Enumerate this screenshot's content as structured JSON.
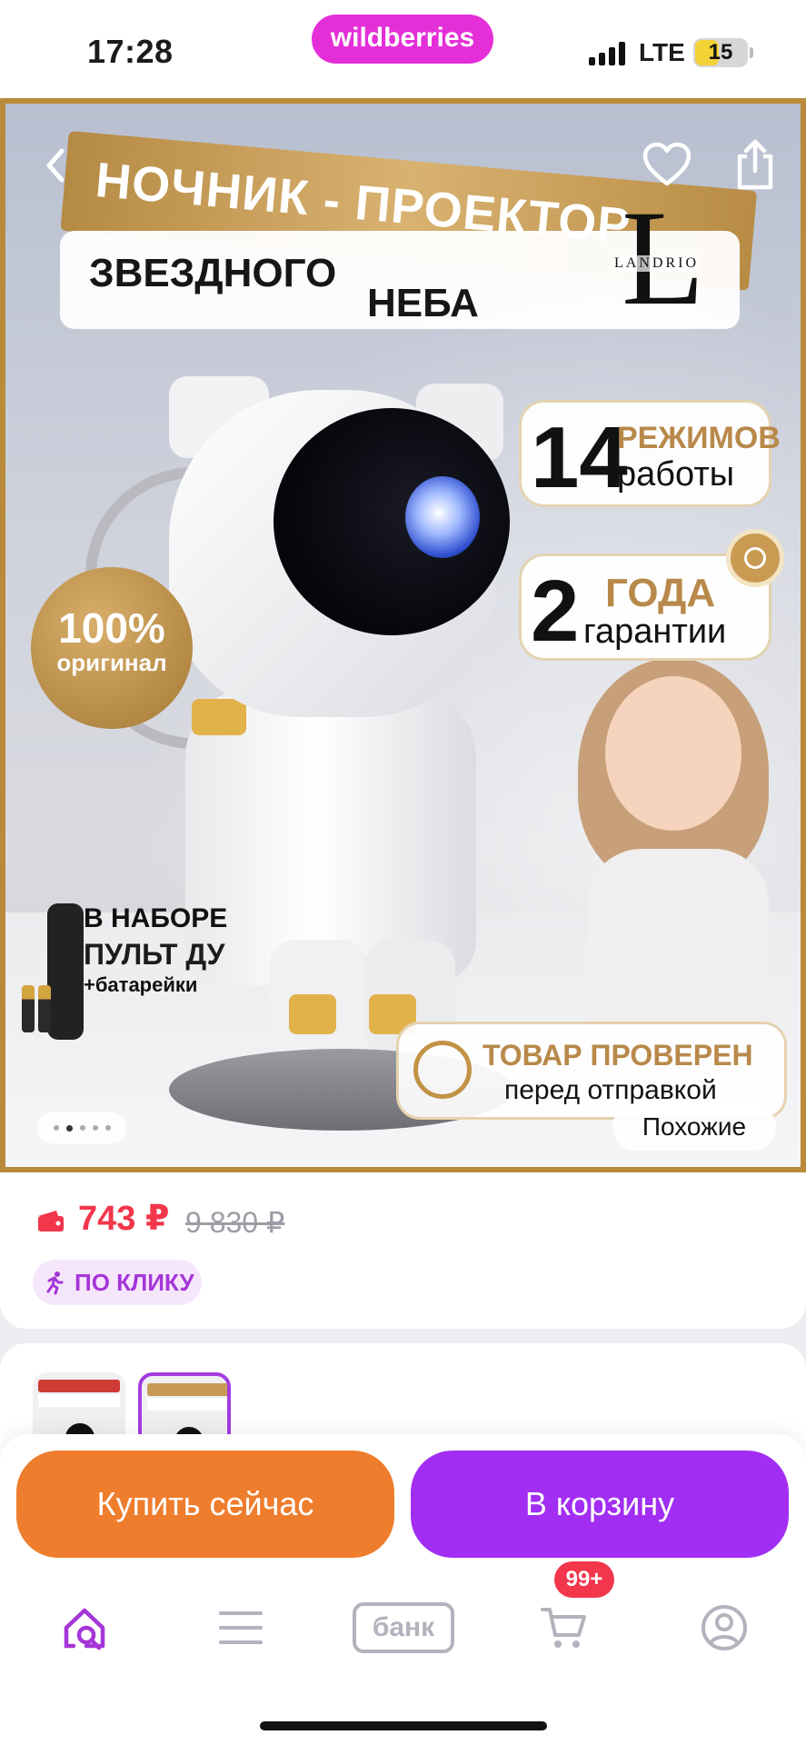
{
  "status_bar": {
    "time": "17:28",
    "brand": "wildberries",
    "network": "LTE",
    "battery": "15"
  },
  "product_image": {
    "headline": "НОЧНИК - ПРОЕКТОР",
    "subline_1": "ЗВЕЗДНОГО",
    "subline_2": "НЕБА",
    "logo_letter": "L",
    "logo_word": "LANDRIO",
    "modes_number": "14",
    "modes_top": "РЕЖИМОВ",
    "modes_bottom": "работы",
    "warranty_number": "2",
    "warranty_top": "ГОДА",
    "warranty_bottom": "гарантии",
    "seal_top": "100%",
    "seal_bottom": "оригинал",
    "kit_line_1": "В НАБОРЕ",
    "kit_line_2": "ПУЛЬТ ДУ",
    "kit_line_3": "+батарейки",
    "checked_line_1": "ТОВАР ПРОВЕРЕН",
    "checked_line_2": "перед отправкой",
    "similar_button": "Похожие",
    "carousel_dots": 5,
    "carousel_active_index": 1
  },
  "icons": {
    "back": "chevron-left-icon",
    "favorite": "heart-icon",
    "share": "share-icon",
    "wallet": "wallet-icon",
    "click": "running-person-icon"
  },
  "price": {
    "current": "743 ₽",
    "old": "9 830 ₽",
    "promo_badge": "ПО КЛИКУ"
  },
  "actions": {
    "buy_now": "Купить сейчас",
    "add_to_cart": "В корзину"
  },
  "tabbar": {
    "bank_label": "банк",
    "cart_badge": "99+"
  },
  "colors": {
    "brand": "#e42fd8",
    "price": "#f2364b",
    "buy_now": "#ee7d2d",
    "to_cart": "#a12ef2",
    "active_tab": "#a536d8"
  }
}
